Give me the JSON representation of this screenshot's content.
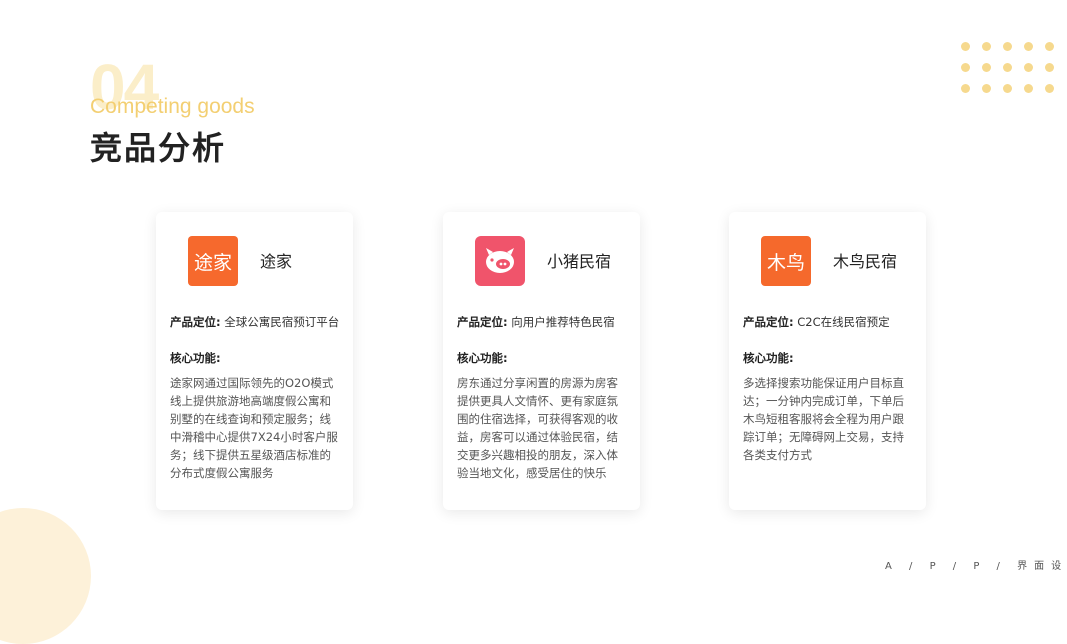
{
  "header": {
    "section_number": "04",
    "subtitle": "Competing goods",
    "title": "竞品分析"
  },
  "cards": [
    {
      "logo_text": "途家",
      "name": "途家",
      "positioning_label": "产品定位:",
      "positioning_value": "全球公寓民宿预订平台",
      "core_label": "核心功能:",
      "core_desc": "途家网通过国际领先的O2O模式线上提供旅游地高端度假公寓和别墅的在线查询和预定服务；线中滑稽中心提供7X24小时客户服务；线下提供五星级酒店标准的分布式度假公寓服务"
    },
    {
      "logo_text": "",
      "name": "小猪民宿",
      "positioning_label": "产品定位:",
      "positioning_value": "向用户推荐特色民宿",
      "core_label": "核心功能:",
      "core_desc": "房东通过分享闲置的房源为房客提供更具人文情怀、更有家庭氛围的住宿选择，可获得客观的收益，房客可以通过体验民宿，结交更多兴趣相投的朋友，深入体验当地文化，感受居住的快乐"
    },
    {
      "logo_text": "木鸟",
      "name": "木鸟民宿",
      "positioning_label": "产品定位:",
      "positioning_value": "C2C在线民宿预定",
      "core_label": "核心功能:",
      "core_desc": "多选择搜索功能保证用户目标直达；一分钟内完成订单，下单后木鸟短租客服将会全程为用户跟踪订单；无障碍网上交易，支持各类支付方式"
    }
  ],
  "footer": {
    "tag": "A / P / P / 界面设计"
  },
  "colors": {
    "accent_yellow": "#f3cf72",
    "tujia_orange": "#f6692d",
    "xiaozhu_pink": "#f0546b",
    "muniao_orange": "#f5692c"
  }
}
